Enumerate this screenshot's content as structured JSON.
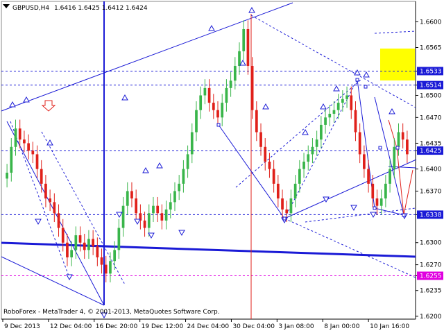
{
  "header": {
    "symbol_label": "GBPUSD,H4",
    "ohlc": "1.6416 1.6425 1.6412 1.6424"
  },
  "footer": {
    "copyright": "RoboForex - MetaTrader 4, © 2001-2013, MetaQuotes Software Corp."
  },
  "colors": {
    "bull": "#39b54a",
    "bear": "#e0201a",
    "line": "#1a1ad6",
    "level_blue": "#1a1ad6",
    "level_magenta": "#e000e0",
    "highlight": "#ffff00",
    "tag_blue": "#1a1ad6",
    "tag_magenta": "#e000e0"
  },
  "icons": {
    "down_arrow": "triangle-down-icon",
    "up_arrow": "triangle-up-icon",
    "signal": "red-down-arrow-icon"
  },
  "chart_data": {
    "type": "candlestick",
    "symbol": "GBPUSD",
    "timeframe": "H4",
    "ylim": [
      1.6198,
      1.6622
    ],
    "y_ticks": [
      "1.6600",
      "1.6565",
      "1.6533",
      "1.6514",
      "1.6500",
      "1.6470",
      "1.6435",
      "1.6425",
      "1.6400",
      "1.6370",
      "1.6338",
      "1.6300",
      "1.6270",
      "1.6255",
      "1.6235",
      "1.6200"
    ],
    "x_ticks": [
      "9 Dec 2013",
      "12 Dec 04:00",
      "16 Dec 20:00",
      "19 Dec 12:00",
      "24 Dec 04:00",
      "30 Dec 04:00",
      "3 Jan 08:00",
      "8 Jan 00:00",
      "10 Jan 16:00"
    ],
    "levels": [
      {
        "price": 1.6533,
        "label": "1.6533",
        "color": "blue"
      },
      {
        "price": 1.6514,
        "label": "1.6514",
        "color": "blue"
      },
      {
        "price": 1.6425,
        "label": "1.6425",
        "color": "blue"
      },
      {
        "price": 1.6338,
        "label": "1.6338",
        "color": "blue"
      },
      {
        "price": 1.6255,
        "label": "1.6255",
        "color": "magenta"
      }
    ],
    "candles_close": [
      1.6395,
      1.643,
      1.6455,
      1.644,
      1.6435,
      1.6425,
      1.642,
      1.64,
      1.638,
      1.636,
      1.6355,
      1.634,
      1.632,
      1.63,
      1.628,
      1.629,
      1.631,
      1.63,
      1.629,
      1.6305,
      1.6295,
      1.628,
      1.627,
      1.6258,
      1.6275,
      1.629,
      1.632,
      1.635,
      1.637,
      1.636,
      1.634,
      1.633,
      1.632,
      1.634,
      1.635,
      1.634,
      1.633,
      1.6345,
      1.6355,
      1.637,
      1.638,
      1.64,
      1.642,
      1.645,
      1.648,
      1.65,
      1.651,
      1.649,
      1.648,
      1.647,
      1.649,
      1.651,
      1.652,
      1.654,
      1.656,
      1.659,
      1.654,
      1.648,
      1.645,
      1.643,
      1.641,
      1.64,
      1.638,
      1.636,
      1.6345,
      1.634,
      1.636,
      1.638,
      1.64,
      1.641,
      1.642,
      1.643,
      1.644,
      1.646,
      1.647,
      1.6475,
      1.648,
      1.649,
      1.6495,
      1.65,
      1.648,
      1.645,
      1.642,
      1.64,
      1.638,
      1.636,
      1.635,
      1.636,
      1.638,
      1.64,
      1.643,
      1.645,
      1.644,
      1.642
    ]
  }
}
